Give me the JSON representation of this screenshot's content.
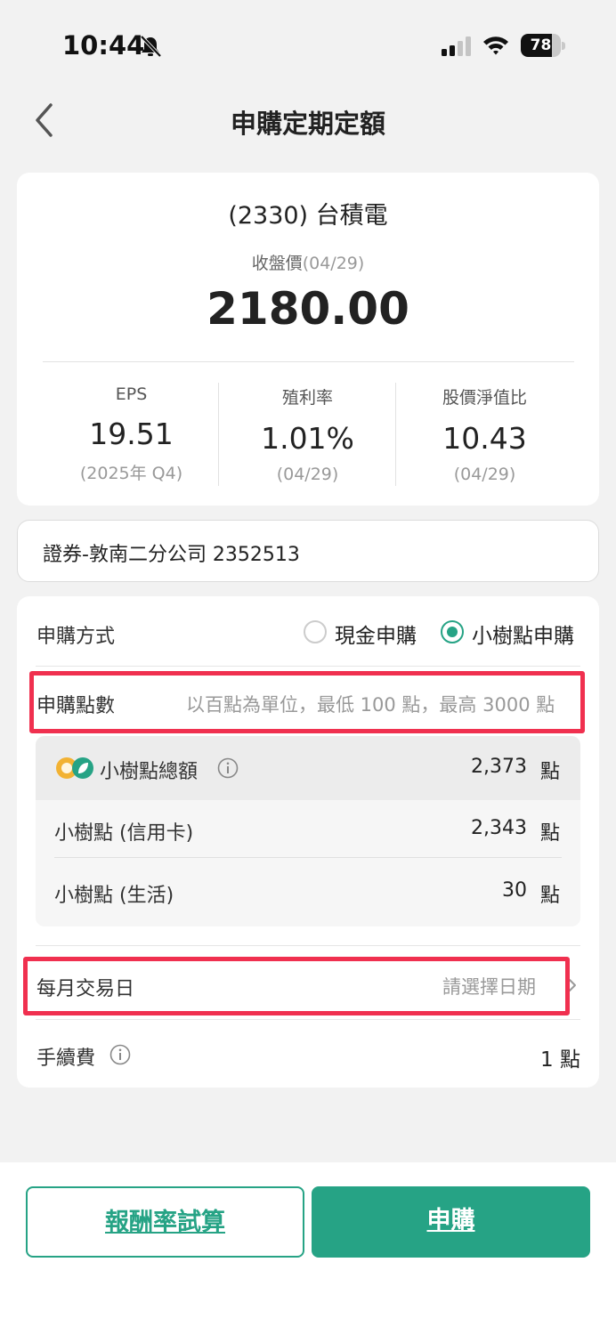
{
  "status": {
    "time": "10:44",
    "battery": "78",
    "battery_level": 0.78
  },
  "nav": {
    "title": "申購定期定額"
  },
  "stock": {
    "name": "(2330) 台積電",
    "close_label": "收盤價",
    "close_date": "(04/29)",
    "price": "2180.00",
    "metrics": [
      {
        "label": "EPS",
        "value": "19.51",
        "sub": "(2025年 Q4)"
      },
      {
        "label": "殖利率",
        "value": "1.01%",
        "sub": "(04/29)"
      },
      {
        "label": "股價淨值比",
        "value": "10.43",
        "sub": "(04/29)"
      }
    ]
  },
  "account": {
    "text": "證券-敦南二分公司 2352513"
  },
  "form": {
    "method_label": "申購方式",
    "options": [
      {
        "label": "現金申購",
        "selected": false
      },
      {
        "label": "小樹點申購",
        "selected": true
      }
    ],
    "points_label": "申購點數",
    "points_placeholder": "以百點為單位，最低 100 點，最高 3000 點",
    "balance": {
      "total_label": "小樹點總額",
      "total_value": "2,373",
      "unit": "點",
      "rows": [
        {
          "label": "小樹點 (信用卡)",
          "value": "2,343"
        },
        {
          "label": "小樹點 (生活)",
          "value": "30"
        }
      ]
    },
    "date_label": "每月交易日",
    "date_placeholder": "請選擇日期",
    "fee_label": "手續費",
    "fee_value": "1 點"
  },
  "footer": {
    "calc_label": "報酬率試算",
    "submit_label": "申購"
  },
  "colors": {
    "accent": "#26a385",
    "highlight": "#f0304f"
  }
}
